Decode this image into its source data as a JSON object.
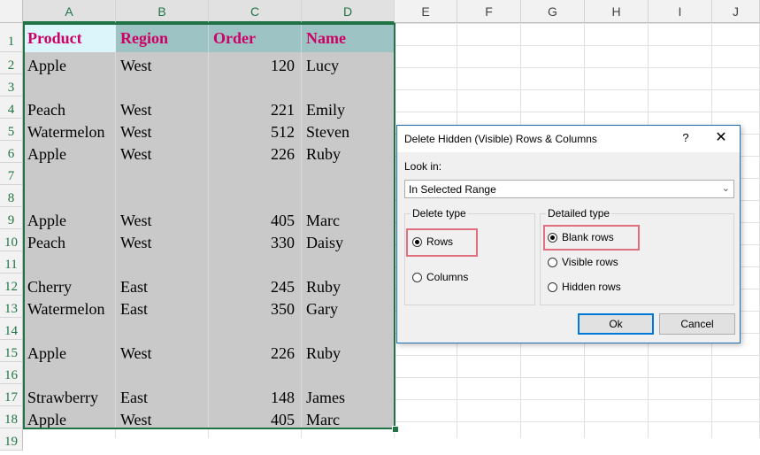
{
  "spreadsheet": {
    "columns": [
      "A",
      "B",
      "C",
      "D",
      "E",
      "F",
      "G",
      "H",
      "I",
      "J"
    ],
    "rows": [
      "1",
      "2",
      "3",
      "4",
      "5",
      "6",
      "7",
      "8",
      "9",
      "10",
      "11",
      "12",
      "13",
      "14",
      "15",
      "16",
      "17",
      "18",
      "19"
    ],
    "header": {
      "product": "Product",
      "region": "Region",
      "order": "Order",
      "name": "Name"
    },
    "data": [
      {
        "product": "Apple",
        "region": "West",
        "order": "120",
        "name": "Lucy"
      },
      {
        "product": "",
        "region": "",
        "order": "",
        "name": ""
      },
      {
        "product": "Peach",
        "region": "West",
        "order": "221",
        "name": "Emily"
      },
      {
        "product": "Watermelon",
        "region": "West",
        "order": "512",
        "name": "Steven"
      },
      {
        "product": "Apple",
        "region": "West",
        "order": "226",
        "name": "Ruby"
      },
      {
        "product": "",
        "region": "",
        "order": "",
        "name": ""
      },
      {
        "product": "",
        "region": "",
        "order": "",
        "name": ""
      },
      {
        "product": "Apple",
        "region": "West",
        "order": "405",
        "name": "Marc"
      },
      {
        "product": "Peach",
        "region": "West",
        "order": "330",
        "name": "Daisy"
      },
      {
        "product": "",
        "region": "",
        "order": "",
        "name": ""
      },
      {
        "product": "Cherry",
        "region": "East",
        "order": "245",
        "name": "Ruby"
      },
      {
        "product": "Watermelon",
        "region": "East",
        "order": "350",
        "name": "Gary"
      },
      {
        "product": "",
        "region": "",
        "order": "",
        "name": ""
      },
      {
        "product": "Apple",
        "region": "West",
        "order": "226",
        "name": "Ruby"
      },
      {
        "product": "",
        "region": "",
        "order": "",
        "name": ""
      },
      {
        "product": "Strawberry",
        "region": "East",
        "order": "148",
        "name": "James"
      },
      {
        "product": "Apple",
        "region": "West",
        "order": "405",
        "name": "Marc"
      }
    ],
    "colors": {
      "header_text": "#cc0066",
      "header_bg": "#9dc3c4",
      "selection_bg": "#c9c9c9",
      "selection_border": "#217346"
    }
  },
  "dialog": {
    "title": "Delete Hidden (Visible) Rows & Columns",
    "help": "?",
    "close": "✕",
    "look_in_label": "Look in:",
    "look_in_value": "In Selected Range",
    "delete_type": {
      "label": "Delete type",
      "options": [
        "Rows",
        "Columns"
      ],
      "selected": "Rows"
    },
    "detailed_type": {
      "label": "Detailed type",
      "options": [
        "Blank rows",
        "Visible rows",
        "Hidden rows"
      ],
      "selected": "Blank rows"
    },
    "ok_label": "Ok",
    "cancel_label": "Cancel",
    "highlight_color": "#e0707f"
  }
}
